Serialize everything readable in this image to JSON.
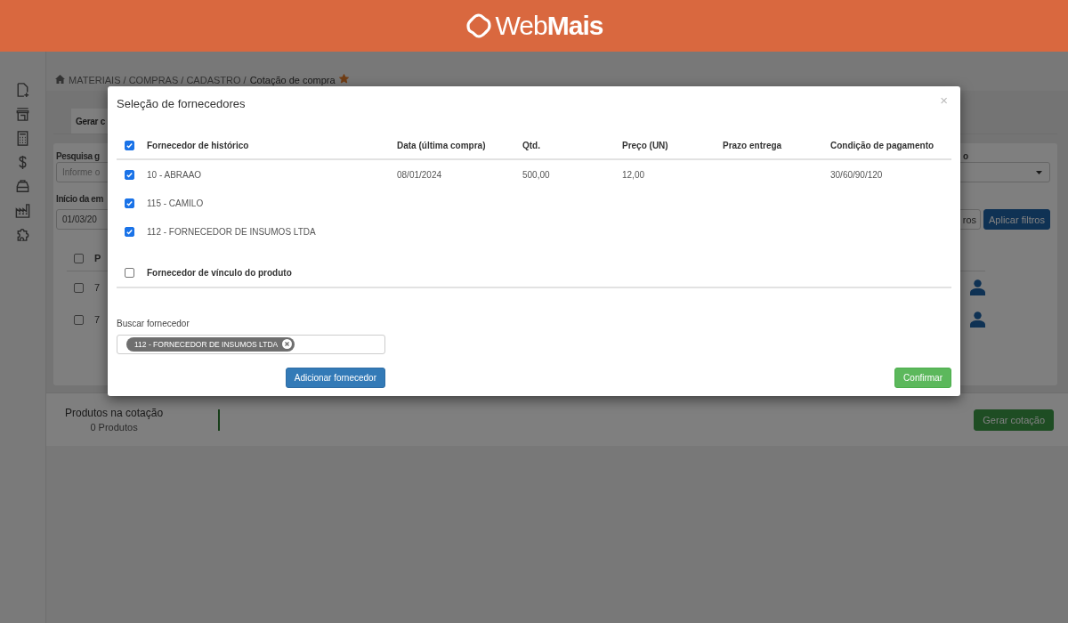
{
  "header": {
    "logo": "Web**Mais**"
  },
  "breadcrumb": {
    "path": "MATERIAIS / COMPRAS / CADASTRO / ",
    "current": "Cotação de compra",
    "favorite": true
  },
  "tabs": [
    {
      "label": "Gerar c",
      "selected": true
    }
  ],
  "filters": {
    "search_label": "Pesquisa g",
    "search_placeholder": "Informe o",
    "start_label": "Início da em",
    "start_value": "01/03/20",
    "right_label": "o",
    "buttons": [
      "ros",
      "Aplicar filtros"
    ]
  },
  "table": {
    "header_checked": false,
    "column_1": "P",
    "rows": [
      {
        "checked": false,
        "cell": "7"
      },
      {
        "checked": false,
        "cell": "7"
      }
    ]
  },
  "summary": {
    "title": "Produtos na cotação",
    "count": "0 Produtos",
    "button": "Gerar cotação"
  },
  "modal": {
    "title": "Seleção de fornecedores",
    "close": "×",
    "history": {
      "checked": true,
      "columns": {
        "supplier": "Fornecedor de histórico",
        "date": "Data (última compra)",
        "qty": "Qtd.",
        "price": "Preço (UN)",
        "delivery": "Prazo entrega",
        "payment": "Condição de pagamento"
      },
      "rows": [
        {
          "checked": true,
          "supplier": "10 - ABRAAO",
          "date": "08/01/2024",
          "qty": "500,00",
          "price": "12,00",
          "payment": "30/60/90/120"
        },
        {
          "checked": true,
          "supplier": "115 - CAMILO"
        },
        {
          "checked": true,
          "supplier": "112 - FORNECEDOR DE INSUMOS LTDA"
        }
      ]
    },
    "product_link": {
      "label": "Fornecedor de vínculo do produto",
      "checked": false
    },
    "search": {
      "label": "Buscar fornecedor",
      "chips": [
        "112 - FORNECEDOR DE INSUMOS LTDA"
      ]
    },
    "buttons": {
      "add": "Adicionar fornecedor",
      "confirm": "Confirmar"
    }
  }
}
